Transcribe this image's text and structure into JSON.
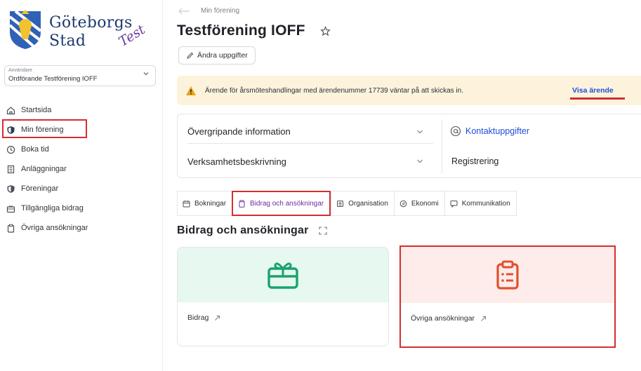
{
  "brand": {
    "name_line1": "Göteborgs",
    "name_line2": "Stad",
    "env_badge": "Test"
  },
  "user": {
    "caption": "Användare",
    "value": "Ordförande Testförening IOFF"
  },
  "nav": {
    "items": [
      {
        "label": "Startsida",
        "icon": "home-icon"
      },
      {
        "label": "Min förening",
        "icon": "shield-icon",
        "active": true
      },
      {
        "label": "Boka tid",
        "icon": "clock-icon"
      },
      {
        "label": "Anläggningar",
        "icon": "building-icon"
      },
      {
        "label": "Föreningar",
        "icon": "shield-icon"
      },
      {
        "label": "Tillgängliga bidrag",
        "icon": "gift-card-icon"
      },
      {
        "label": "Övriga ansökningar",
        "icon": "clipboard-icon"
      }
    ]
  },
  "header": {
    "breadcrumb": "Min förening",
    "title": "Testförening IOFF",
    "edit_label": "Ändra uppgifter"
  },
  "alert": {
    "message": "Ärende för årsmöteshandlingar med ärendenummer 17739 väntar på att skickas in.",
    "link_label": "Visa ärende"
  },
  "info": {
    "general": "Övergripande information",
    "activity": "Verksamhetsbeskrivning",
    "contact": "Kontaktuppgifter",
    "registration": "Registrering"
  },
  "tabs": [
    {
      "label": "Bokningar",
      "icon": "calendar-icon"
    },
    {
      "label": "Bidrag och ansökningar",
      "icon": "clipboard-icon",
      "active": true
    },
    {
      "label": "Organisation",
      "icon": "org-icon"
    },
    {
      "label": "Ekonomi",
      "icon": "coin-icon"
    },
    {
      "label": "Kommunikation",
      "icon": "chat-icon"
    }
  ],
  "section": {
    "title": "Bidrag och ansökningar"
  },
  "cards": [
    {
      "label": "Bidrag",
      "icon": "gift-card-icon"
    },
    {
      "label": "Övriga ansökningar",
      "icon": "clipboard-icon"
    }
  ],
  "colors": {
    "accent_red": "#d32f2f",
    "link_blue": "#1d4ed8",
    "alert_bg": "#fdf3dc",
    "green": "#1aa36f",
    "orange_red": "#e2502d",
    "purple": "#6b2fa0"
  }
}
